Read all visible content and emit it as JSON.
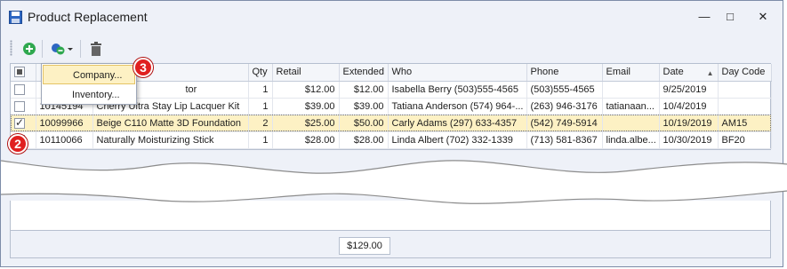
{
  "window": {
    "title": "Product Replacement",
    "minimize_glyph": "—",
    "maximize_glyph": "□",
    "close_glyph": "✕"
  },
  "toolbar": {
    "buttons": [
      {
        "icon": "add-icon"
      },
      {
        "icon": "link-dropdown-icon"
      },
      {
        "icon": "delete-icon"
      }
    ]
  },
  "dropdown_menu": {
    "items": [
      {
        "label": "Company..."
      },
      {
        "label": "Inventory..."
      }
    ]
  },
  "table": {
    "columns": [
      "",
      "",
      "",
      "Qty",
      "Retail",
      "Extended",
      "Who",
      "Phone",
      "Email",
      "Date",
      "Day Code"
    ],
    "sort_column": "Date",
    "rows": [
      {
        "checked": false,
        "code": "",
        "description": "tor",
        "qty": "1",
        "retail": "$12.00",
        "extended": "$12.00",
        "who": "Isabella Berry (503)555-4565",
        "phone": "(503)555-4565",
        "email": "",
        "date": "9/25/2019",
        "day_code": ""
      },
      {
        "checked": false,
        "code": "10145194",
        "description": "Cherry Ultra Stay Lip Lacquer Kit",
        "qty": "1",
        "retail": "$39.00",
        "extended": "$39.00",
        "who": "Tatiana Anderson (574) 964-...",
        "phone": "(263) 946-3176",
        "email": "tatianaan...",
        "date": "10/4/2019",
        "day_code": ""
      },
      {
        "checked": true,
        "code": "10099966",
        "description": "Beige C110 Matte 3D Foundation",
        "qty": "2",
        "retail": "$25.00",
        "extended": "$50.00",
        "who": "Carly Adams (297) 633-4357",
        "phone": "(542) 749-5914",
        "email": "",
        "date": "10/19/2019",
        "day_code": "AM15"
      },
      {
        "checked": false,
        "code": "10110066",
        "description": "Naturally Moisturizing Stick",
        "qty": "1",
        "retail": "$28.00",
        "extended": "$28.00",
        "who": "Linda Albert (702) 332-1339",
        "phone": "(713) 581-8367",
        "email": "linda.albe...",
        "date": "10/30/2019",
        "day_code": "BF20"
      }
    ]
  },
  "footer": {
    "total": "$129.00"
  },
  "callouts": [
    "2",
    "3"
  ],
  "colors": {
    "accent_red": "#e02020",
    "selected_row": "#fdf1c4",
    "add_green": "#2fa84f"
  }
}
